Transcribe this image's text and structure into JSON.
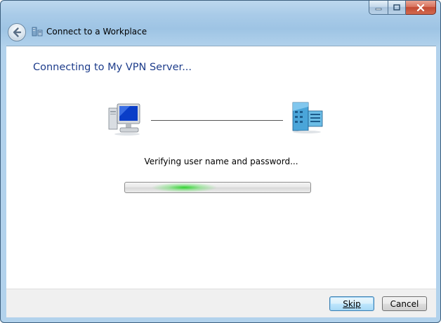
{
  "window": {
    "caption_buttons": [
      "minimize",
      "maximize",
      "close"
    ]
  },
  "header": {
    "title": "Connect to a Workplace",
    "back_icon": "back-arrow-icon",
    "app_icon": "workplace-network-icon"
  },
  "main": {
    "heading": "Connecting to My VPN Server...",
    "status": "Verifying user name and password...",
    "progress": {
      "style": "indeterminate-marquee",
      "glow_position_fraction": 0.32
    },
    "icons": [
      "computer-icon",
      "server-icon"
    ]
  },
  "footer": {
    "skip_label": "Skip",
    "cancel_label": "Cancel"
  },
  "colors": {
    "heading": "#1e3d8b",
    "progress_glow": "#28d228",
    "window_frame": "#a9cbe8",
    "close_button": "#c24a33"
  }
}
